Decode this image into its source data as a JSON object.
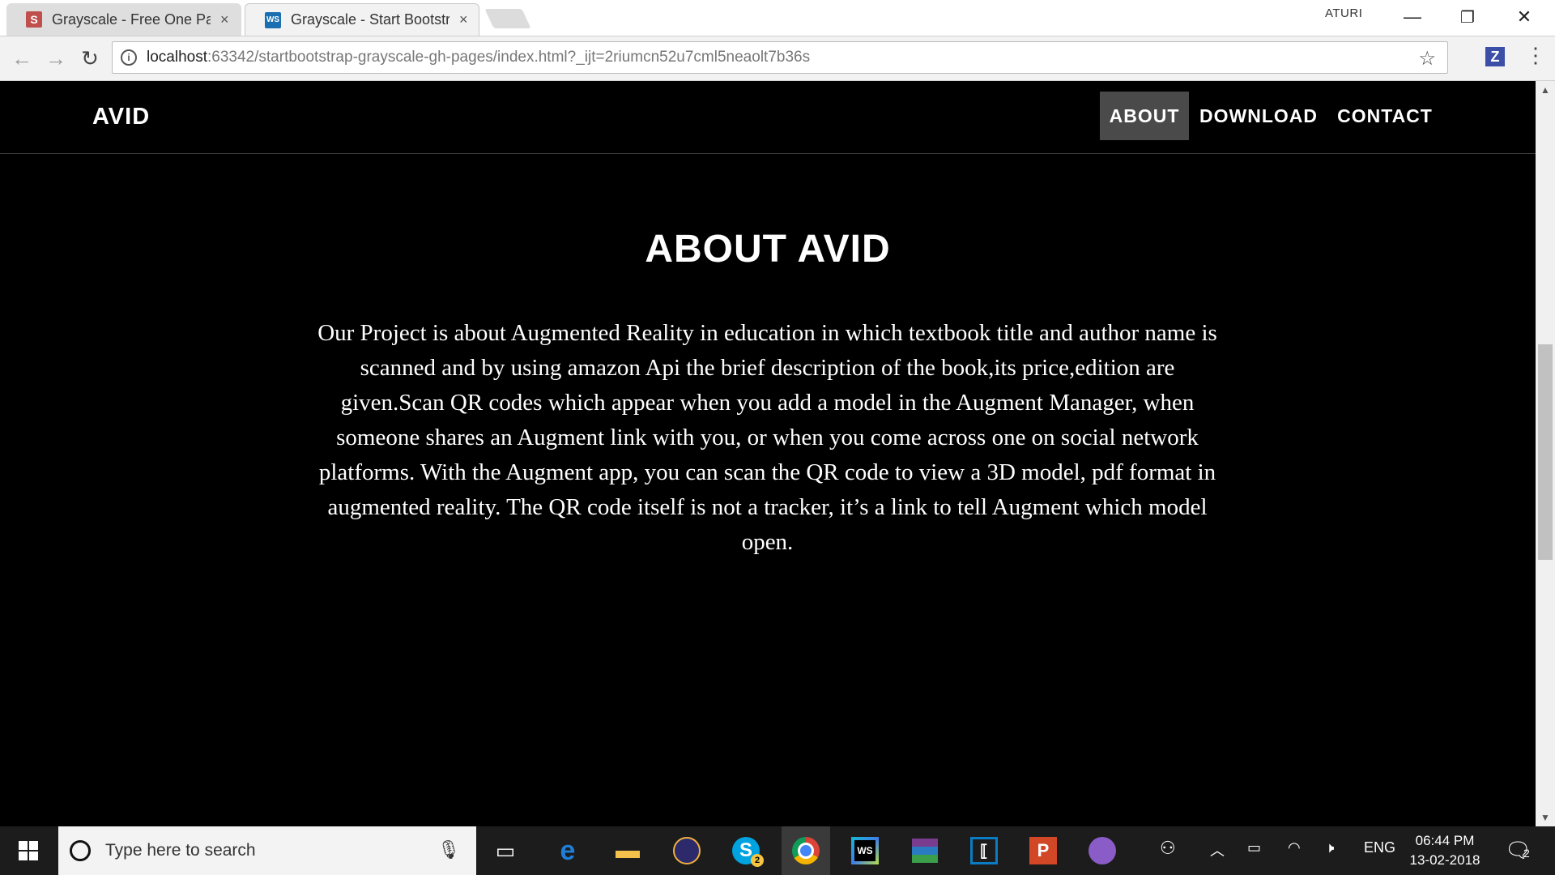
{
  "browser": {
    "tabs": [
      {
        "title": "Grayscale - Free One Page",
        "favicon_letter": "S",
        "favicon_color": "#c0504d",
        "close": "×",
        "active": false
      },
      {
        "title": "Grayscale - Start Bootstrap",
        "favicon_letter": "WS",
        "favicon_color": "#1a6fb0",
        "close": "×",
        "active": true
      }
    ],
    "window_user": "ATURI",
    "address": {
      "host": "localhost",
      "rest": ":63342/startbootstrap-grayscale-gh-pages/index.html?_ijt=2riumcn52u7cml5neaolt7b36s"
    },
    "extension_letter": "Z"
  },
  "page": {
    "brand": "AVID",
    "nav": [
      {
        "label": "ABOUT",
        "active": true
      },
      {
        "label": "DOWNLOAD",
        "active": false
      },
      {
        "label": "CONTACT",
        "active": false
      }
    ],
    "about": {
      "title": "ABOUT AVID",
      "body": "Our Project is about Augmented Reality in education in which textbook title and author name is scanned and by using amazon Api the brief description of the book,its price,edition are given.Scan QR codes which appear when you add a model in the Augment Manager, when someone shares an Augment link with you, or when you come across one on social network platforms. With the Augment app, you can scan the QR code to view a 3D model, pdf format in augmented reality. The QR code itself is not a tracker, it’s a link to tell Augment which model open."
    }
  },
  "taskbar": {
    "search_placeholder": "Type here to search",
    "apps": [
      {
        "name": "task-view",
        "glyph": "⧉"
      },
      {
        "name": "edge",
        "glyph": "e"
      },
      {
        "name": "file-explorer",
        "glyph": "▬"
      },
      {
        "name": "eclipse",
        "glyph": "◉"
      },
      {
        "name": "skype",
        "glyph": "S"
      },
      {
        "name": "chrome",
        "glyph": "◎"
      },
      {
        "name": "webstorm",
        "glyph": "WS"
      },
      {
        "name": "winrar",
        "glyph": "▦"
      },
      {
        "name": "app-bracket",
        "glyph": "⟦"
      },
      {
        "name": "powerpoint",
        "glyph": "P"
      },
      {
        "name": "github",
        "glyph": "●"
      }
    ],
    "language": "ENG",
    "time": "06:44 PM",
    "date": "13-02-2018",
    "notification_count": "2",
    "skype_badge": "2"
  },
  "colors": {
    "page_bg": "#000000",
    "nav_active_bg": "#4a4a4a",
    "text": "#ffffff"
  }
}
